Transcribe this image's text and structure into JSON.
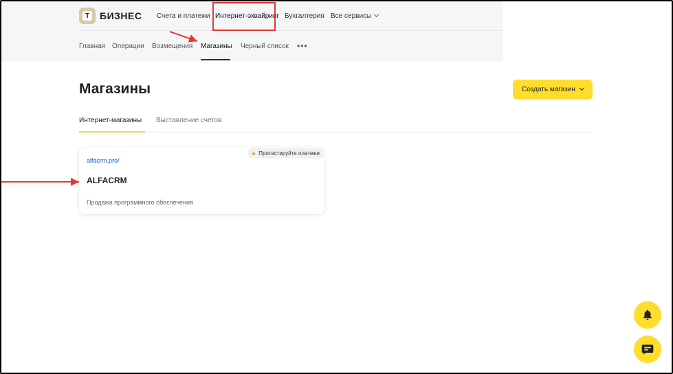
{
  "brand": {
    "logo_letter": "Т",
    "name": "БИЗНЕС"
  },
  "top_nav": [
    {
      "label": "Счета и платежи"
    },
    {
      "label": "Интернет-эквайринг",
      "active": true
    },
    {
      "label": "Бухгалтерия"
    },
    {
      "label": "Все сервисы"
    }
  ],
  "sub_nav": [
    {
      "label": "Главная"
    },
    {
      "label": "Операции"
    },
    {
      "label": "Возмещения"
    },
    {
      "label": "Магазины",
      "active": true
    },
    {
      "label": "Черный список"
    }
  ],
  "more_label": "•••",
  "page": {
    "title": "Магазины",
    "create_button": "Создать магазин"
  },
  "tabs": [
    {
      "label": "Интернет-магазины",
      "active": true
    },
    {
      "label": "Выставление счетов"
    }
  ],
  "shop_card": {
    "url": "alfacrm.pro/",
    "badge": "Протестируйте платежи",
    "name": "ALFACRM",
    "description": "Продажа программного обеспечения"
  },
  "colors": {
    "accent": "#ffdd2d",
    "annotation": "#e53935",
    "link": "#1a5fb4",
    "badge_dot": "#f6a623"
  },
  "icons": [
    "bell-icon",
    "chat-icon",
    "chevron-down-icon"
  ]
}
